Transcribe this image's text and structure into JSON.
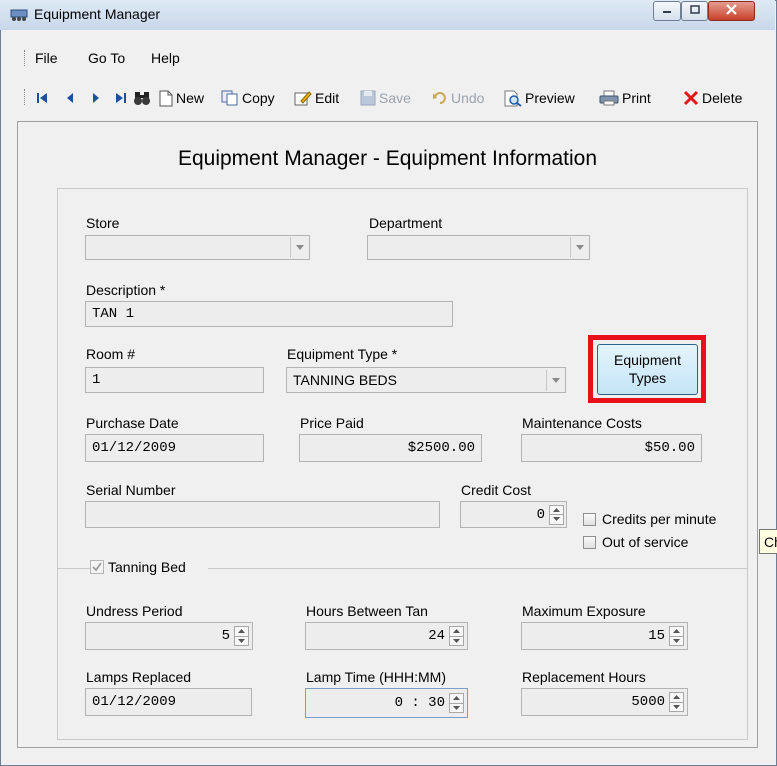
{
  "window": {
    "title": "Equipment Manager"
  },
  "menu": {
    "file": "File",
    "goto": "Go To",
    "help": "Help"
  },
  "toolbar": {
    "new": "New",
    "copy": "Copy",
    "edit": "Edit",
    "save": "Save",
    "undo": "Undo",
    "preview": "Preview",
    "print": "Print",
    "delete": "Delete"
  },
  "form": {
    "heading": "Equipment Manager - Equipment Information",
    "store": {
      "label": "Store",
      "value": ""
    },
    "department": {
      "label": "Department",
      "value": ""
    },
    "description": {
      "label": "Description *",
      "value": "TAN 1"
    },
    "room": {
      "label": "Room #",
      "value": "1"
    },
    "equipment_type": {
      "label": "Equipment Type *",
      "value": "TANNING BEDS"
    },
    "equipment_types_button": {
      "line1": "Equipment",
      "line2": "Types"
    },
    "purchase_date": {
      "label": "Purchase Date",
      "value": "01/12/2009"
    },
    "price_paid": {
      "label": "Price Paid",
      "value": "$2500.00"
    },
    "maintenance_costs": {
      "label": "Maintenance Costs",
      "value": "$50.00"
    },
    "serial_number": {
      "label": "Serial Number",
      "value": ""
    },
    "credit_cost": {
      "label": "Credit Cost",
      "value": "0"
    },
    "credits_per_minute": {
      "label": "Credits per minute",
      "checked": false
    },
    "out_of_service": {
      "label": "Out of service",
      "checked": false
    },
    "tanning_bed": {
      "label": "Tanning Bed",
      "checked": true
    },
    "undress_period": {
      "label": "Undress Period",
      "value": "5"
    },
    "hours_between_tan": {
      "label": "Hours Between Tan",
      "value": "24"
    },
    "maximum_exposure": {
      "label": "Maximum Exposure",
      "value": "15"
    },
    "lamps_replaced": {
      "label": "Lamps Replaced",
      "value": "01/12/2009"
    },
    "lamp_time": {
      "label": "Lamp Time (HHH:MM)",
      "value": "0 : 30"
    },
    "replacement_hours": {
      "label": "Replacement Hours",
      "value": "5000"
    }
  },
  "tooltip": {
    "text": "Check"
  },
  "colors": {
    "highlight": "#e8111a",
    "accent": "#2c628b"
  }
}
